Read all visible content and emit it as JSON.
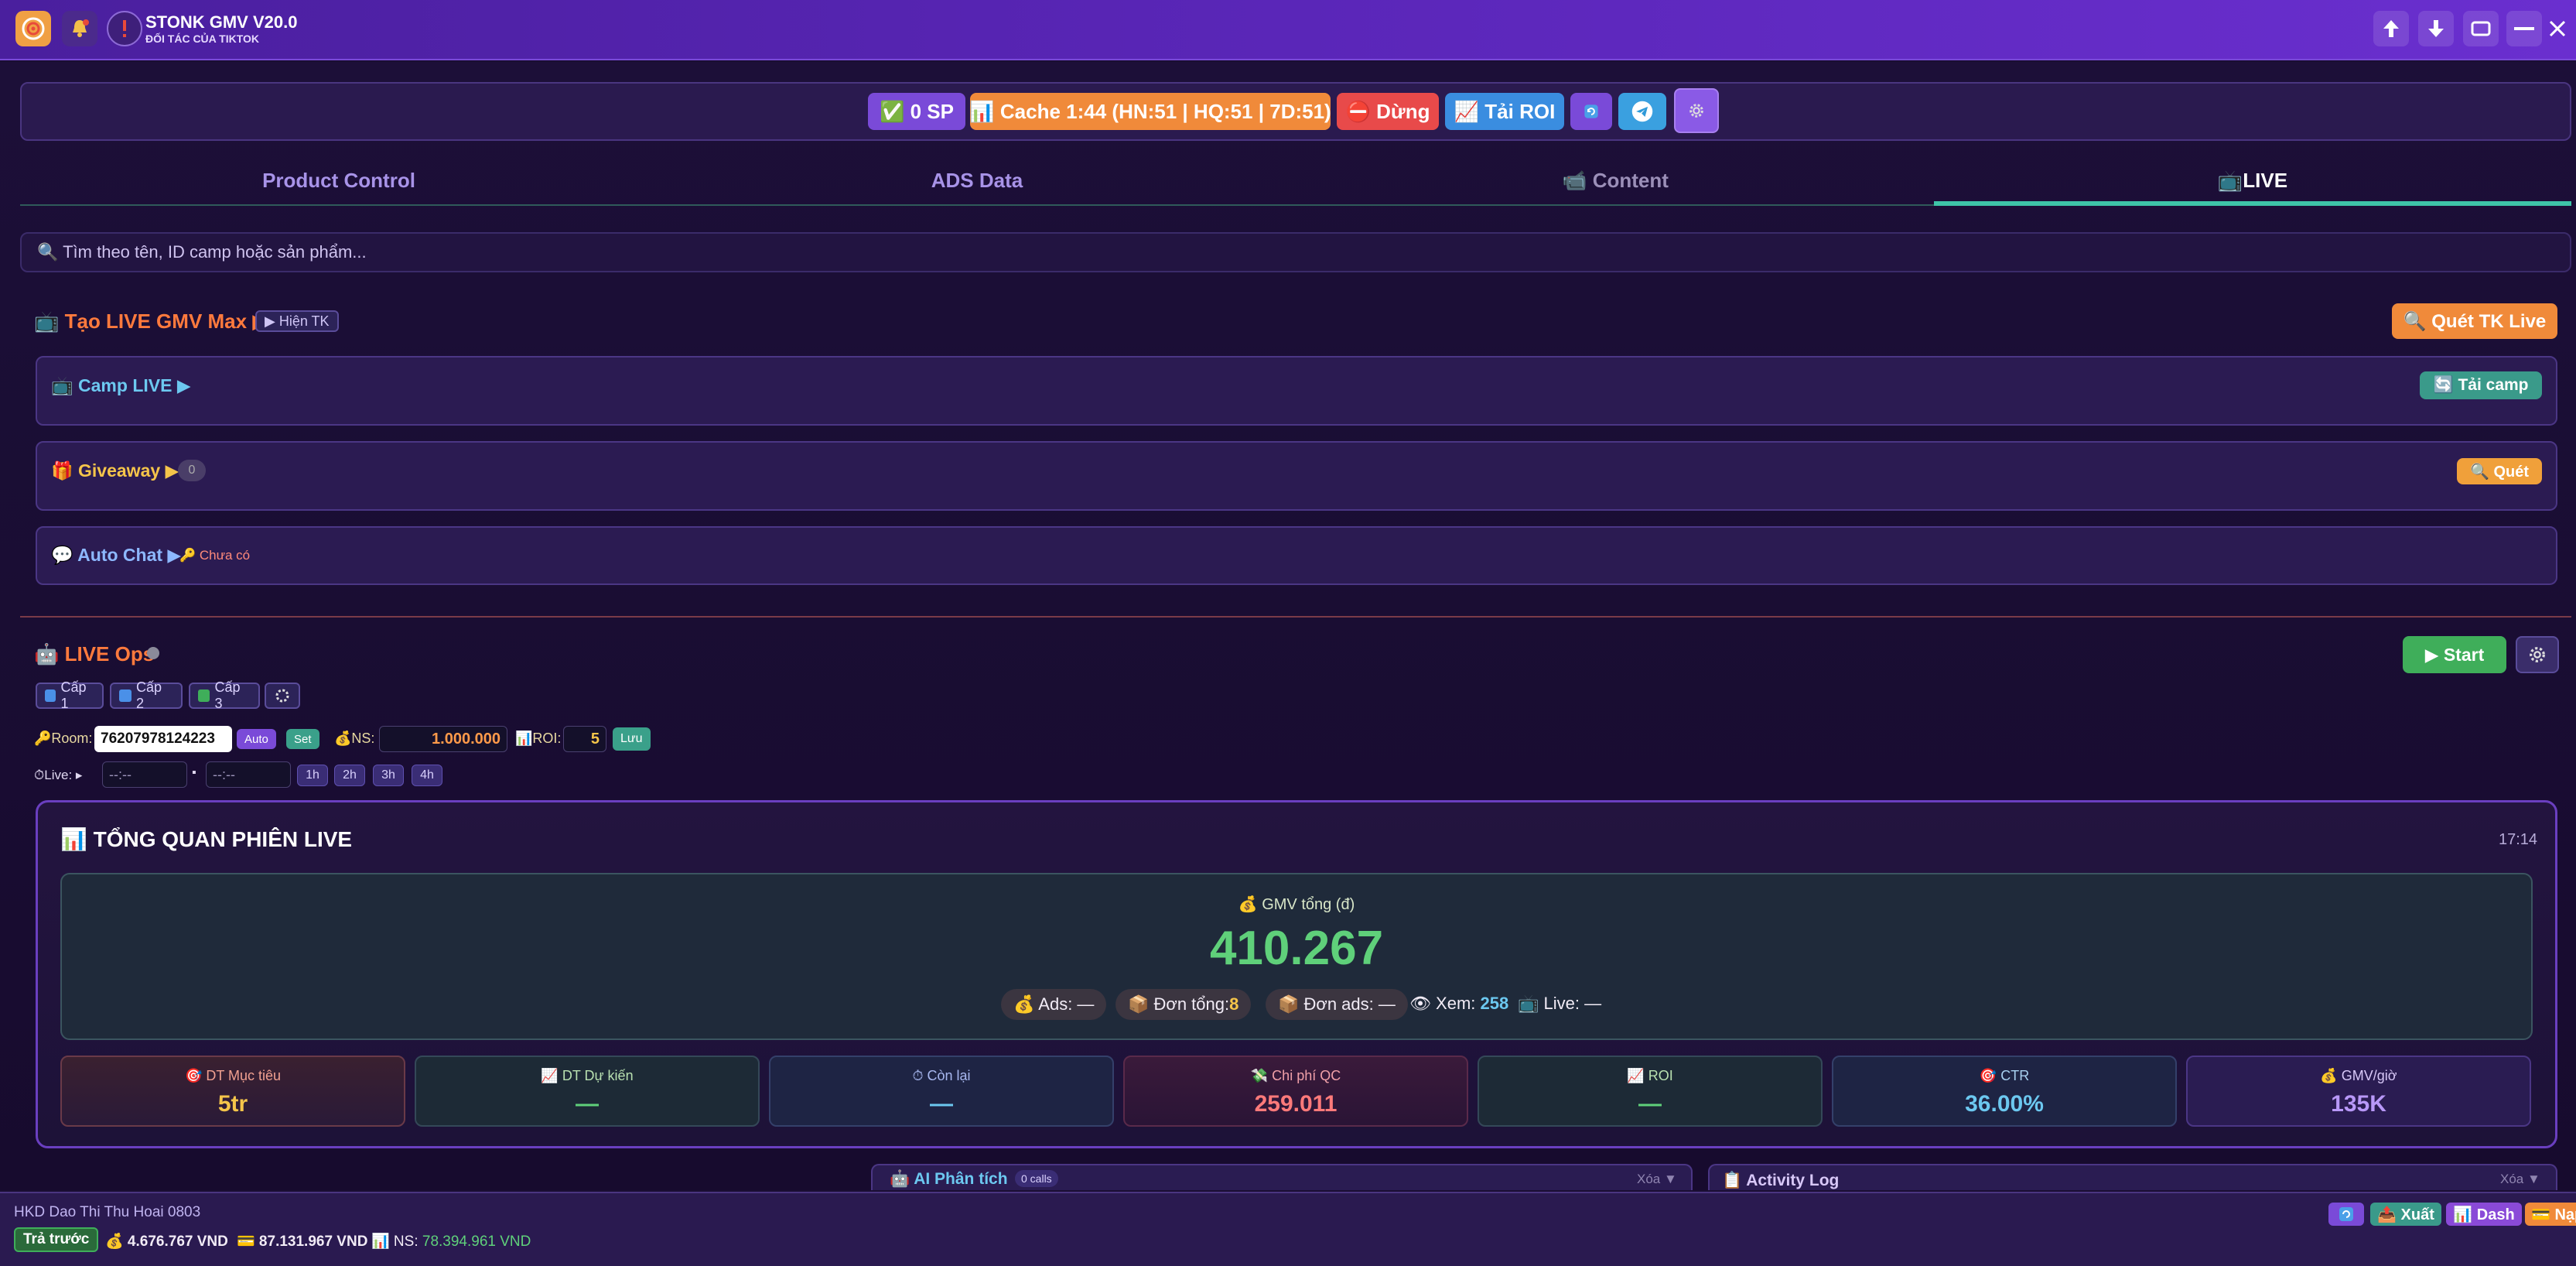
{
  "titlebar": {
    "app_name": "STONK GMV V20.0",
    "app_subtitle": "ĐỐI TÁC CỦA TIKTOK"
  },
  "toolbar": {
    "sp_label": "✅ 0 SP",
    "cache_label": "📊 Cache 1:44 (HN:51 | HQ:51 | 7D:51)",
    "stop_label": "⛔ Dừng",
    "roi_label": "📈 Tải ROI"
  },
  "tabs": [
    {
      "label": "Product Control"
    },
    {
      "label": "ADS Data"
    },
    {
      "label": "📹 Content"
    },
    {
      "label": "📺LIVE"
    }
  ],
  "search": {
    "placeholder": "🔍 Tìm theo tên, ID camp hoặc sản phẩm..."
  },
  "create_live": {
    "title": "📺 Tạo LIVE GMV Max ▶",
    "show_account": "▶ Hiện TK",
    "scan_button": "🔍 Quét TK Live"
  },
  "camp_live": {
    "title": "📺 Camp LIVE ▶",
    "load_button": "🔄 Tải camp"
  },
  "giveaway": {
    "title": "🎁 Giveaway ▶",
    "count": "0",
    "scan_button": "🔍 Quét"
  },
  "auto_chat": {
    "title": "💬 Auto Chat ▶",
    "status": "🔑 Chưa có"
  },
  "live_ops": {
    "title": "🤖 LIVE Ops",
    "start_button": "▶ Start",
    "levels": [
      "Cấp 1",
      "Cấp 2",
      "Cấp 3"
    ],
    "room_label": "🔑Room:",
    "room_value": "76207978124223",
    "auto_label": "Auto",
    "set_label": "Set",
    "ns_label": "💰NS:",
    "ns_value": "1.000.000",
    "roi_label": "📊ROI:",
    "roi_value": "5",
    "save_label": "Lưu",
    "live_label": "⏱Live: ▸",
    "time_start": "--:--",
    "time_sep": "▪",
    "time_end": "--:--",
    "durations": [
      "1h",
      "2h",
      "3h",
      "4h"
    ]
  },
  "overview": {
    "title": "📊 TỔNG QUAN PHIÊN LIVE",
    "time": "17:14",
    "gmv_label": "💰 GMV tổng (đ)",
    "gmv_value": "410.267",
    "pills": {
      "ads": "💰 Ads: —",
      "orders_total_label": "📦 Đơn tổng: ",
      "orders_total_value": "8",
      "orders_ads": "📦 Đơn ads: —",
      "views_label": "👁 Xem: ",
      "views_value": "258",
      "live": "📺 Live: —"
    },
    "stats": [
      {
        "label": "🎯 DT Mục tiêu",
        "value": "5tr"
      },
      {
        "label": "📈 DT Dự kiến",
        "value": "—"
      },
      {
        "label": "⏱ Còn lại",
        "value": "—"
      },
      {
        "label": "💸 Chi phí QC",
        "value": "259.011"
      },
      {
        "label": "📈 ROI",
        "value": "—"
      },
      {
        "label": "🎯 CTR",
        "value": "36.00%"
      },
      {
        "label": "💰 GMV/giờ",
        "value": "135K"
      }
    ]
  },
  "ai_panel": {
    "title": "🤖 AI Phân tích",
    "calls": "0 calls",
    "clear": "Xóa ▼"
  },
  "activity_panel": {
    "title": "📋 Activity Log",
    "clear": "Xóa ▼"
  },
  "statusbar": {
    "account": "HKD Dao Thi Thu Hoai 0803",
    "prepaid": "Trả trước",
    "balance1": "💰 4.676.767 VND",
    "balance2": "💳 87.131.967 VND",
    "ns_label": "📊 NS: ",
    "ns_value": "78.394.961 VND",
    "export": "📤 Xuất",
    "dash": "📊 Dash",
    "topup": "💳 Nạp"
  },
  "colors": {
    "accent_orange": "#ff7a3d",
    "accent_green": "#5fd07a",
    "accent_teal": "#3ec4a8",
    "brand_purple": "#5a26b8"
  }
}
